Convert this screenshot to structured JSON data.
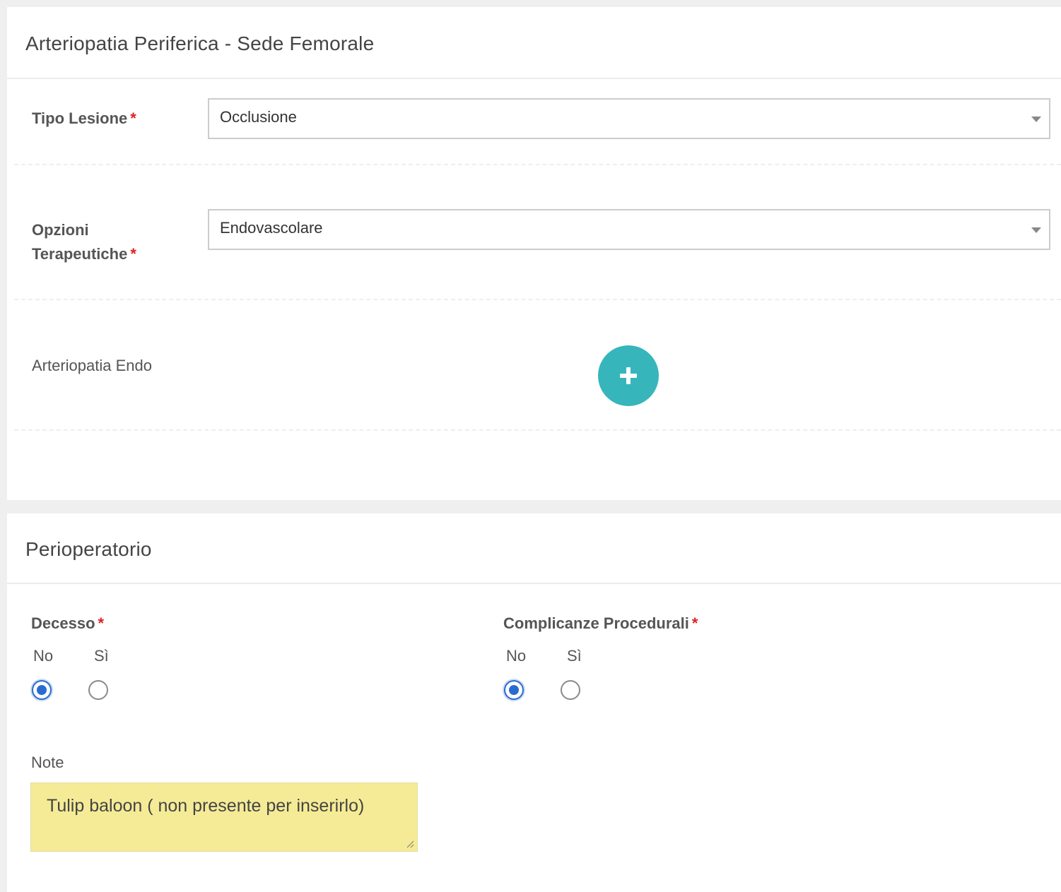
{
  "section1": {
    "title": "Arteriopatia Periferica - Sede Femorale",
    "tipo_lesione": {
      "label": "Tipo Lesione",
      "required_mark": "*",
      "selected": "Occlusione"
    },
    "opzioni_terapeutiche": {
      "label_line1": "Opzioni",
      "label_line2": "Terapeutiche",
      "required_mark": "*",
      "selected": "Endovascolare"
    },
    "arteriopatia_endo": {
      "label": "Arteriopatia Endo",
      "add_button_icon": "plus-icon"
    }
  },
  "section2": {
    "title": "Perioperatorio",
    "decesso": {
      "label": "Decesso",
      "required_mark": "*",
      "options": [
        "No",
        "Sì"
      ],
      "selected": "No"
    },
    "complicanze": {
      "label": "Complicanze Procedurali",
      "required_mark": "*",
      "options": [
        "No",
        "Sì"
      ],
      "selected": "No"
    },
    "note": {
      "label": "Note",
      "value": "Tulip baloon ( non presente per inserirlo)"
    }
  },
  "colors": {
    "accent_teal": "#36b6bb",
    "radio_blue": "#2a6bd1",
    "required_red": "#e02020",
    "note_background": "#f5eb96"
  }
}
